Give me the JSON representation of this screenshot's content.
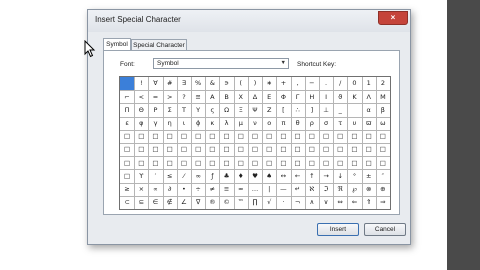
{
  "dialog": {
    "title": "Insert Special Character",
    "close_glyph": "×"
  },
  "tabs": [
    {
      "label": "Symbol",
      "active": true
    },
    {
      "label": "Special Character",
      "active": false
    }
  ],
  "font": {
    "label": "Font:",
    "value": "Symbol",
    "dropdown_glyph": "▼"
  },
  "shortcut": {
    "label": "Shortcut Key:"
  },
  "symbol_grid": {
    "columns": 19,
    "rows": 10,
    "selected_index": 0,
    "cells": [
      " ",
      "!",
      "∀",
      "#",
      "∃",
      "%",
      "&",
      "∍",
      "(",
      ")",
      "∗",
      "+",
      ",",
      "−",
      ".",
      "/",
      "0",
      "1",
      "2",
      "⌐",
      "<",
      "=",
      ">",
      "?",
      "≅",
      "Α",
      "Β",
      "Χ",
      "Δ",
      "Ε",
      "Φ",
      "Γ",
      "Η",
      "Ι",
      "ϑ",
      "Κ",
      "Λ",
      "Μ",
      "Π",
      "Θ",
      "Ρ",
      "Σ",
      "Τ",
      "Υ",
      "ς",
      "Ω",
      "Ξ",
      "Ψ",
      "Ζ",
      "[",
      "∴",
      "]",
      "⊥",
      "_",
      "",
      "α",
      "β",
      "ε",
      "φ",
      "γ",
      "η",
      "ι",
      "ϕ",
      "κ",
      "λ",
      "μ",
      "ν",
      "ο",
      "π",
      "θ",
      "ρ",
      "σ",
      "τ",
      "υ",
      "ϖ",
      "ω",
      "□",
      "□",
      "□",
      "□",
      "□",
      "□",
      "□",
      "□",
      "□",
      "□",
      "□",
      "□",
      "□",
      "□",
      "□",
      "□",
      "□",
      "□",
      "□",
      "□",
      "□",
      "□",
      "□",
      "□",
      "□",
      "□",
      "□",
      "□",
      "□",
      "□",
      "□",
      "□",
      "□",
      "□",
      "□",
      "□",
      "□",
      "□",
      "□",
      "□",
      "□",
      "□",
      "□",
      "□",
      "□",
      "□",
      "□",
      "□",
      "□",
      "□",
      "□",
      "□",
      "□",
      "□",
      "□",
      "□",
      "□",
      "□",
      "ϒ",
      "′",
      "≤",
      "⁄",
      "∞",
      "ƒ",
      "♣",
      "♦",
      "♥",
      "♠",
      "↔",
      "←",
      "↑",
      "→",
      "↓",
      "°",
      "±",
      "″",
      "≥",
      "×",
      "∝",
      "∂",
      "•",
      "÷",
      "≠",
      "≡",
      "≈",
      "…",
      "|",
      "—",
      "↵",
      "ℵ",
      "ℑ",
      "ℜ",
      "℘",
      "⊗",
      "⊕",
      "⊂",
      "⊆",
      "∈",
      "∉",
      "∠",
      "∇",
      "®",
      "©",
      "™",
      "∏",
      "√",
      "⋅",
      "¬",
      "∧",
      "∨",
      "⇔",
      "⇐",
      "⇑",
      "⇒"
    ]
  },
  "buttons": {
    "insert": "Insert",
    "cancel": "Cancel"
  }
}
